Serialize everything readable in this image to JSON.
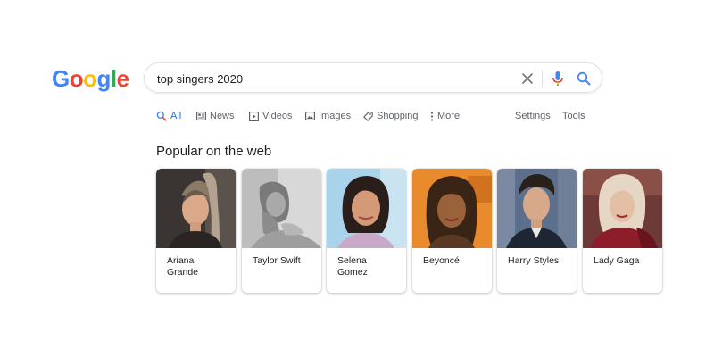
{
  "logo": {
    "text": "Google",
    "letters": [
      {
        "ch": "G",
        "color": "#4285F4"
      },
      {
        "ch": "o",
        "color": "#EA4335"
      },
      {
        "ch": "o",
        "color": "#FBBC05"
      },
      {
        "ch": "g",
        "color": "#4285F4"
      },
      {
        "ch": "l",
        "color": "#34A853"
      },
      {
        "ch": "e",
        "color": "#EA4335"
      }
    ]
  },
  "search": {
    "query": "top singers 2020",
    "clear_icon": "close-icon",
    "voice_icon": "mic-icon",
    "search_icon": "search-icon"
  },
  "tabs": {
    "all": "All",
    "news": "News",
    "videos": "Videos",
    "images": "Images",
    "shopping": "Shopping",
    "more": "More",
    "settings": "Settings",
    "tools": "Tools"
  },
  "section": {
    "title": "Popular on the web"
  },
  "cards": [
    {
      "name": "Ariana Grande",
      "line1": "Ariana",
      "line2": "Grande"
    },
    {
      "name": "Taylor Swift",
      "line1": "Taylor Swift",
      "line2": ""
    },
    {
      "name": "Selena Gomez",
      "line1": "Selena",
      "line2": "Gomez"
    },
    {
      "name": "Beyoncé",
      "line1": "Beyoncé",
      "line2": ""
    },
    {
      "name": "Harry Styles",
      "line1": "Harry Styles",
      "line2": ""
    },
    {
      "name": "Lady Gaga",
      "line1": "Lady Gaga",
      "line2": ""
    }
  ],
  "colors": {
    "accent": "#1a73e8",
    "text": "#202124",
    "muted": "#5f6368",
    "border": "#dfe1e5"
  }
}
